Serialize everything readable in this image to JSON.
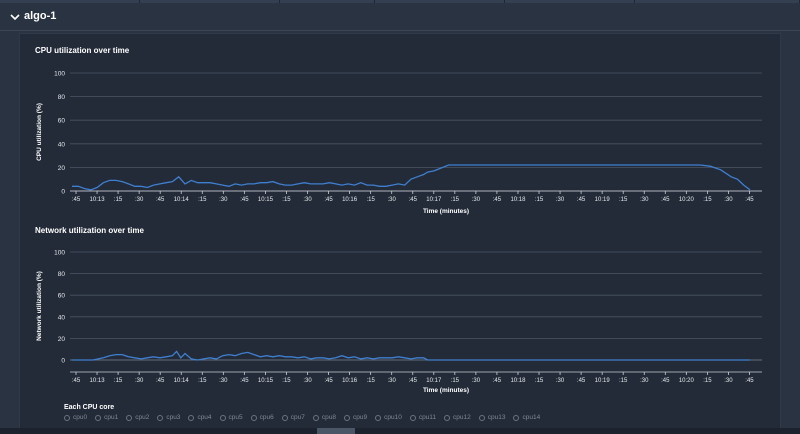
{
  "header": {
    "title": "algo-1"
  },
  "charts_common": {
    "xlabel": "Time (minutes)"
  },
  "chart_data": [
    {
      "type": "line",
      "title": "CPU utilization over time",
      "xlabel": "Time (minutes)",
      "ylabel": "CPU utilization (%)",
      "ylim": [
        0,
        100
      ],
      "yticks": [
        0,
        20,
        40,
        60,
        80,
        100
      ],
      "xtick_labels": [
        ":45",
        "10:13",
        ":15",
        ":30",
        ":45",
        "10:14",
        ":15",
        ":30",
        ":45",
        "10:15",
        ":15",
        ":30",
        ":45",
        "10:16",
        ":15",
        ":30",
        ":45",
        "10:17",
        ":15",
        ":30",
        ":45",
        "10:18",
        ":15",
        ":30",
        ":45",
        "10:19",
        ":15",
        ":30",
        ":45",
        "10:20",
        ":15",
        ":30",
        ":45"
      ],
      "series_color": "#3f7fd0",
      "x": [
        0,
        0.3,
        0.6,
        0.9,
        1.2,
        1.5,
        1.8,
        2.1,
        2.4,
        2.7,
        3.0,
        3.3,
        3.6,
        3.9,
        4.2,
        4.5,
        4.8,
        5.1,
        5.4,
        5.7,
        6.0,
        6.3,
        6.6,
        6.9,
        7.2,
        7.5,
        7.8,
        8.1,
        8.4,
        8.7,
        9.0,
        9.3,
        9.6,
        9.9,
        10.2,
        10.5,
        10.8,
        11.1,
        11.4,
        11.7,
        12.0,
        12.3,
        12.6,
        12.9,
        13.2,
        13.5,
        13.8,
        14.1,
        14.4,
        14.7,
        15.0,
        15.3,
        15.6,
        15.9,
        16.2,
        16.5,
        16.8,
        17.0,
        17.3,
        18,
        19,
        20,
        21,
        22,
        23,
        24,
        25,
        26,
        27,
        28,
        29,
        30,
        30.5,
        31,
        31.5,
        31.8,
        32.1,
        32.4
      ],
      "y": [
        4,
        4,
        2,
        1,
        3,
        7,
        9,
        9,
        8,
        6,
        4,
        4,
        3,
        5,
        6,
        7,
        8,
        12,
        6,
        9,
        7,
        7,
        7,
        6,
        5,
        4,
        6,
        5,
        6,
        6,
        7,
        7,
        8,
        6,
        5,
        5,
        6,
        7,
        6,
        6,
        6,
        7,
        6,
        5,
        6,
        5,
        7,
        5,
        5,
        4,
        4,
        5,
        6,
        5,
        10,
        12,
        14,
        16,
        17,
        22,
        22,
        22,
        22,
        22,
        22,
        22,
        22,
        22,
        22,
        22,
        22,
        22,
        21,
        18,
        12,
        10,
        5,
        1
      ]
    },
    {
      "type": "line",
      "title": "Network utilization over time",
      "xlabel": "Time (minutes)",
      "ylabel": "Network utilization (%)",
      "ylim": [
        0,
        100
      ],
      "yticks": [
        0,
        20,
        40,
        60,
        80,
        100
      ],
      "xtick_labels": [
        ":45",
        "10:13",
        ":15",
        ":30",
        ":45",
        "10:14",
        ":15",
        ":30",
        ":45",
        "10:15",
        ":15",
        ":30",
        ":45",
        "10:16",
        ":15",
        ":30",
        ":45",
        "10:17",
        ":15",
        ":30",
        ":45",
        "10:18",
        ":15",
        ":30",
        ":45",
        "10:19",
        ":15",
        ":30",
        ":45",
        "10:20",
        ":15",
        ":30",
        ":45"
      ],
      "series_color": "#3f7fd0",
      "x": [
        0,
        1,
        1.5,
        1.8,
        2.1,
        2.4,
        2.7,
        3.0,
        3.3,
        3.6,
        3.9,
        4.2,
        4.5,
        4.8,
        5.0,
        5.2,
        5.4,
        5.7,
        6.0,
        6.3,
        6.6,
        6.9,
        7.2,
        7.5,
        7.8,
        8.1,
        8.4,
        8.7,
        9.0,
        9.3,
        9.6,
        9.9,
        10.2,
        10.5,
        10.8,
        11.1,
        11.4,
        11.7,
        12.0,
        12.3,
        12.6,
        12.9,
        13.2,
        13.5,
        13.8,
        14.1,
        14.4,
        14.7,
        15.0,
        15.3,
        15.6,
        15.9,
        16.2,
        16.5,
        16.8,
        17.0,
        17.3,
        18,
        20,
        22,
        24,
        26,
        28,
        30,
        32.4
      ],
      "y": [
        0,
        0,
        2,
        4,
        5,
        5,
        3,
        2,
        1,
        2,
        3,
        2,
        3,
        4,
        8,
        2,
        6,
        1,
        0,
        1,
        2,
        1,
        4,
        5,
        4,
        6,
        7,
        5,
        3,
        4,
        3,
        4,
        3,
        3,
        2,
        3,
        1,
        2,
        2,
        1,
        2,
        4,
        2,
        3,
        1,
        2,
        1,
        2,
        2,
        2,
        3,
        2,
        1,
        2,
        2,
        0,
        0,
        0,
        0,
        0,
        0,
        0,
        0,
        0,
        0
      ]
    }
  ],
  "legend": {
    "title": "Each CPU core",
    "items": [
      "cpu0",
      "cpu1",
      "cpu2",
      "cpu3",
      "cpu4",
      "cpu5",
      "cpu6",
      "cpu7",
      "cpu8",
      "cpu9",
      "cpu10",
      "cpu11",
      "cpu12",
      "cpu13",
      "cpu14"
    ]
  }
}
